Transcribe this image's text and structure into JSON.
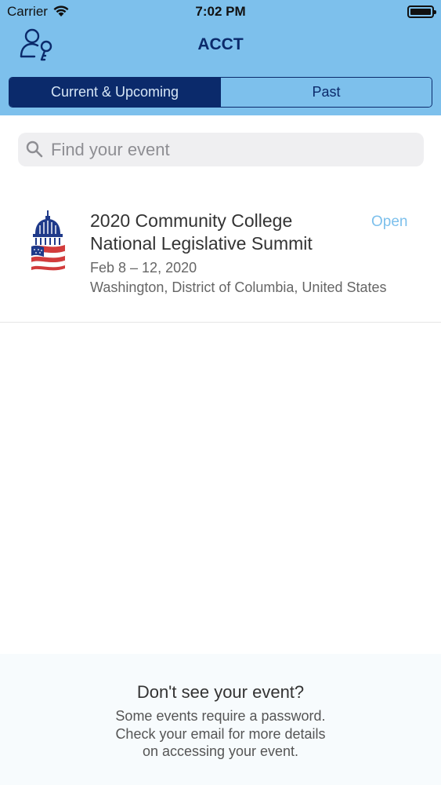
{
  "status_bar": {
    "carrier": "Carrier",
    "time": "7:02 PM",
    "icons": [
      "wifi-icon",
      "battery-icon"
    ]
  },
  "header": {
    "title": "ACCT",
    "profile_icon": "user-key-icon"
  },
  "segmented": {
    "current_label": "Current & Upcoming",
    "past_label": "Past",
    "selected": "Current & Upcoming"
  },
  "search": {
    "placeholder": "Find your event",
    "value": "",
    "icon": "search-icon"
  },
  "events": [
    {
      "title": "2020 Community College National Legislative Summit",
      "badge": "Open",
      "dates": "Feb 8 – 12, 2020",
      "location": "Washington, District of Columbia, United States",
      "logo": "capitol-flag-logo"
    }
  ],
  "footer": {
    "title": "Don't see your event?",
    "lines": [
      "Some events require a password.",
      "Check your email for more details",
      "on accessing your event."
    ]
  },
  "colors": {
    "header_bg": "#7dc0ec",
    "accent_dark": "#0b2a6b",
    "badge": "#7dc0ec"
  }
}
